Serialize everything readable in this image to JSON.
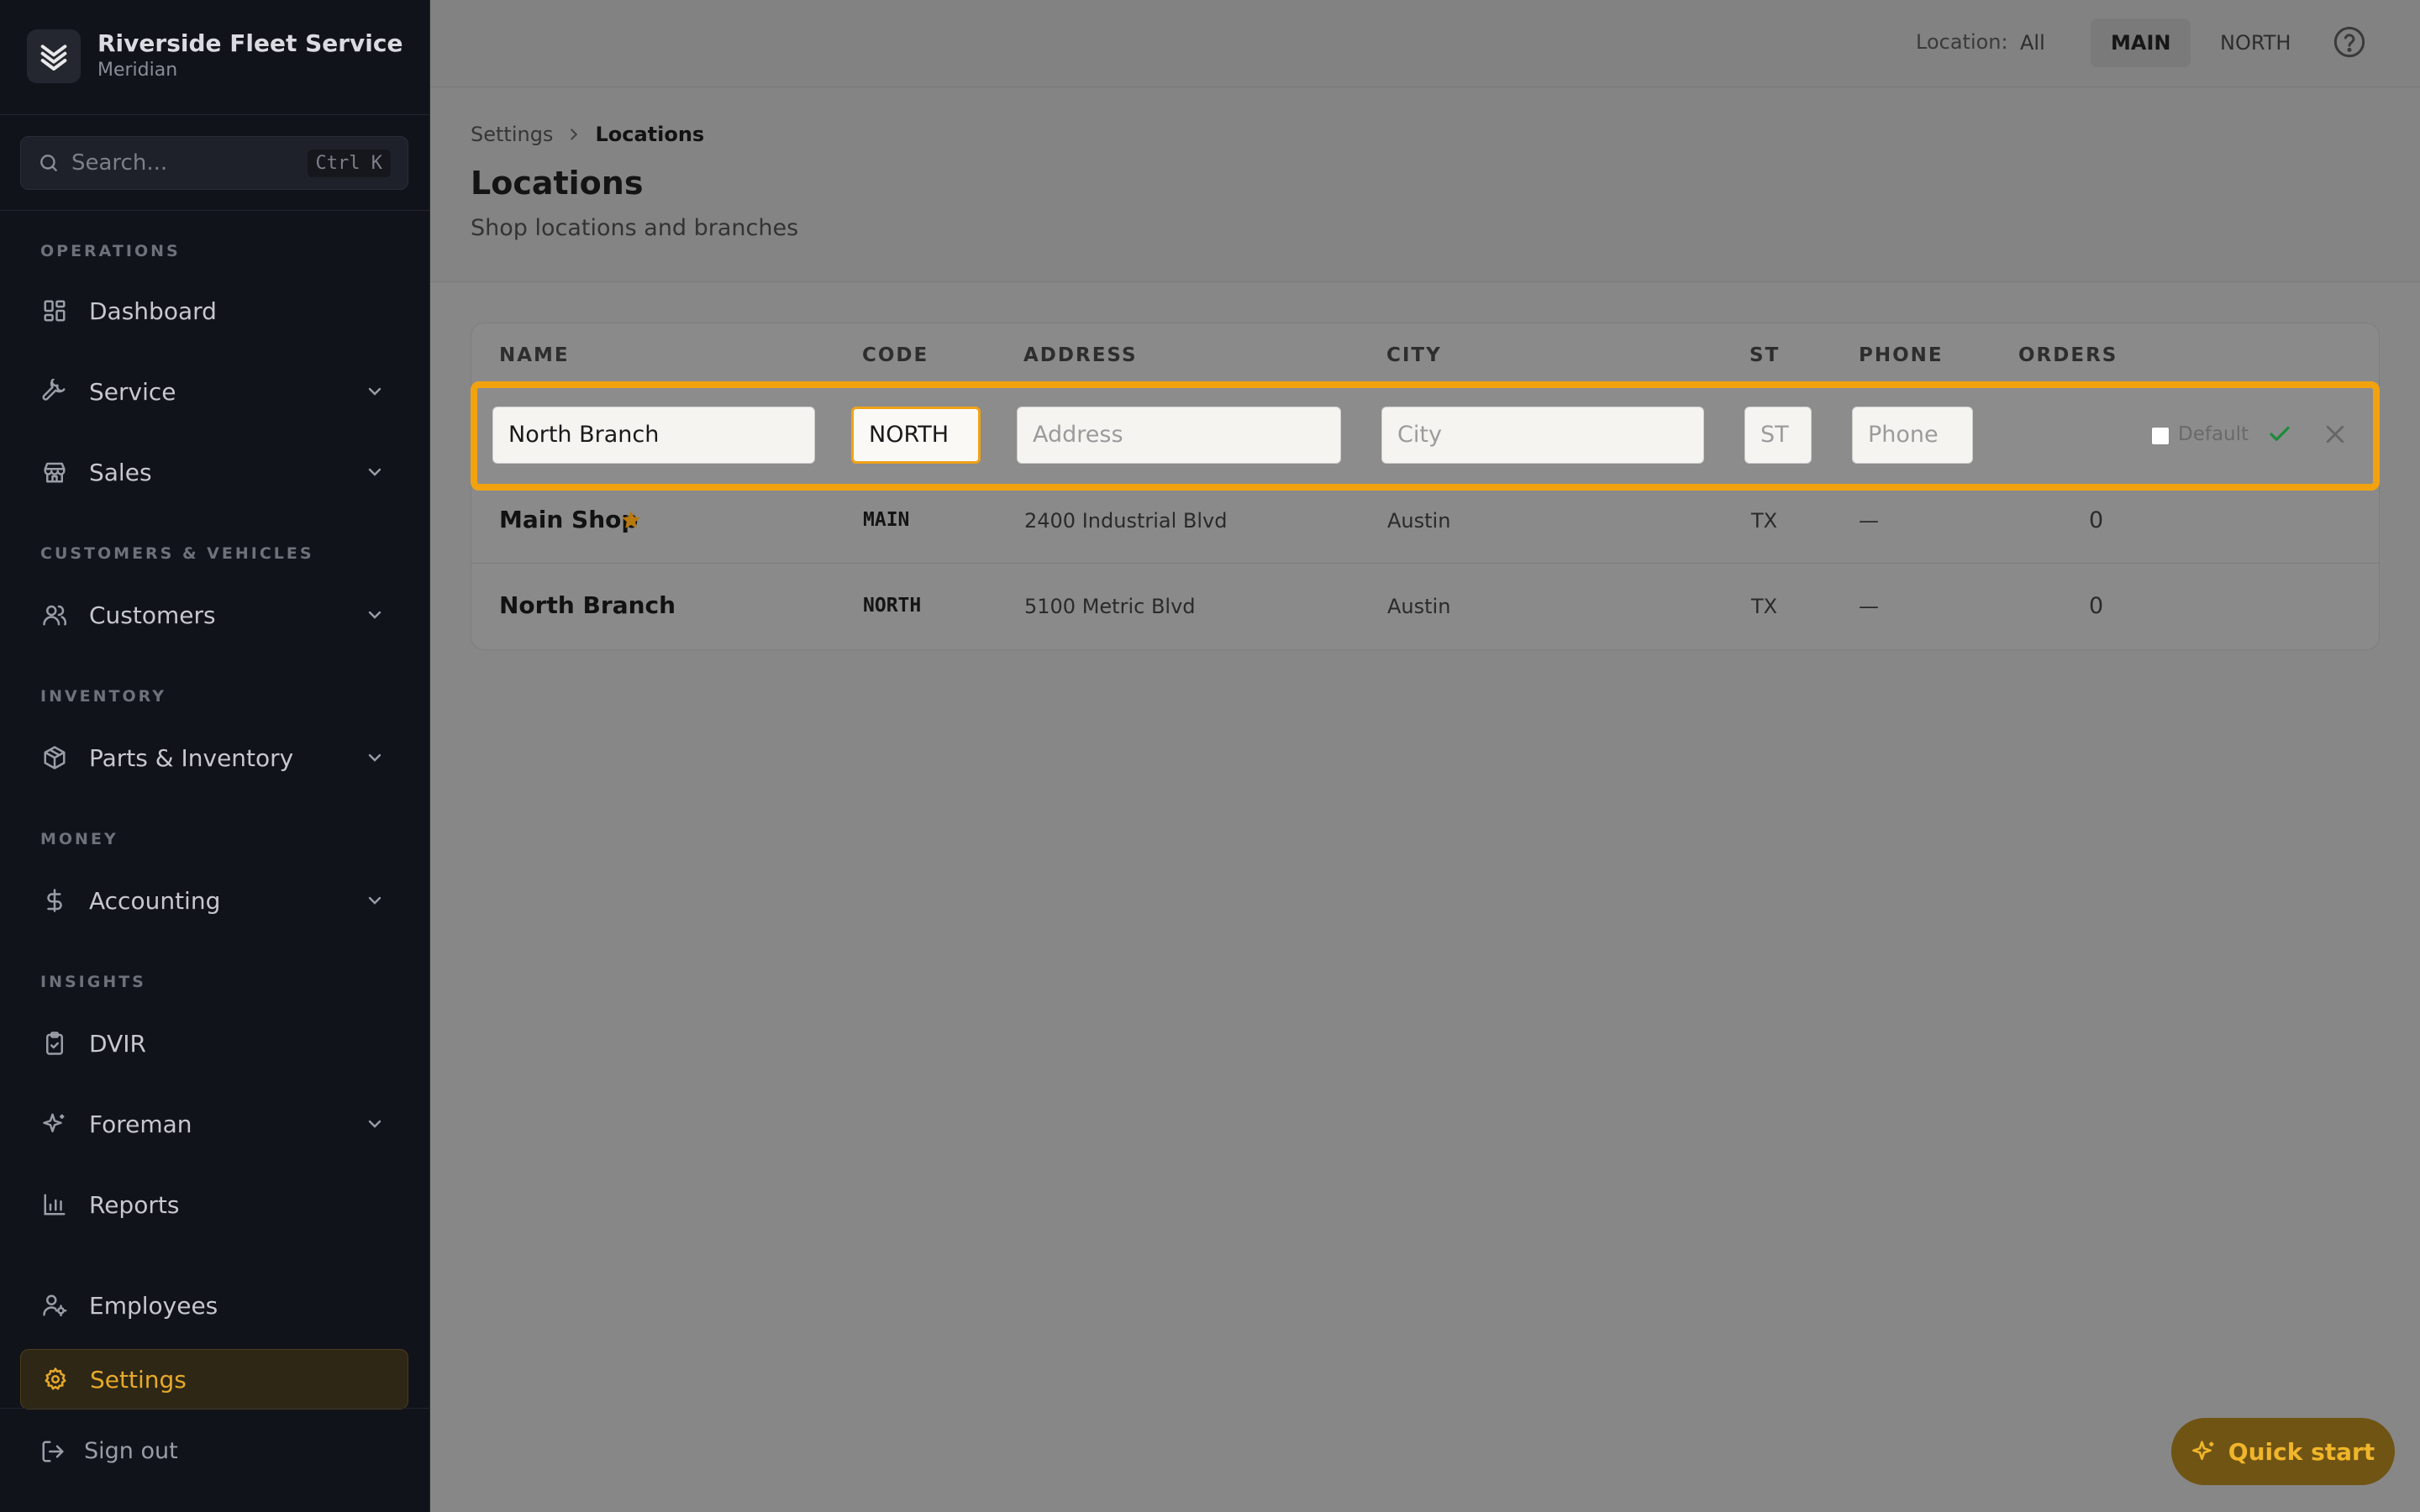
{
  "brand": {
    "name": "Riverside Fleet Service",
    "subtitle": "Meridian"
  },
  "search": {
    "placeholder": "Search...",
    "shortcut": "Ctrl K"
  },
  "sidebar": {
    "sections": [
      "OPERATIONS",
      "CUSTOMERS & VEHICLES",
      "INVENTORY",
      "MONEY",
      "INSIGHTS"
    ],
    "items": [
      {
        "label": "Dashboard",
        "icon": "dashboard-icon"
      },
      {
        "label": "Service",
        "icon": "wrench-icon"
      },
      {
        "label": "Sales",
        "icon": "store-icon"
      },
      {
        "label": "Customers",
        "icon": "users-icon"
      },
      {
        "label": "Parts & Inventory",
        "icon": "box-icon"
      },
      {
        "label": "Accounting",
        "icon": "dollar-icon"
      },
      {
        "label": "DVIR",
        "icon": "clipboard-check-icon"
      },
      {
        "label": "Foreman",
        "icon": "sparkles-icon"
      },
      {
        "label": "Reports",
        "icon": "bar-chart-icon"
      },
      {
        "label": "Employees",
        "icon": "user-cog-icon"
      },
      {
        "label": "Settings",
        "icon": "gear-icon",
        "active": true
      }
    ],
    "signout": "Sign out"
  },
  "topbar": {
    "location_label": "Location:",
    "location_options": [
      "All",
      "MAIN",
      "NORTH"
    ],
    "selected_location": "MAIN"
  },
  "breadcrumb": {
    "parent": "Settings",
    "current": "Locations"
  },
  "page": {
    "title": "Locations",
    "subtitle": "Shop locations and branches"
  },
  "table": {
    "columns": [
      "NAME",
      "CODE",
      "ADDRESS",
      "CITY",
      "ST",
      "PHONE",
      "ORDERS"
    ],
    "edit_row": {
      "name": "North Branch",
      "code": "NORTH",
      "address_placeholder": "Address",
      "city_placeholder": "City",
      "state_placeholder": "ST",
      "phone_placeholder": "Phone",
      "default_label": "Default",
      "default_checked": false
    },
    "rows": [
      {
        "name": "Main Shop",
        "is_default": true,
        "code": "MAIN",
        "address": "2400 Industrial Blvd",
        "city": "Austin",
        "state": "TX",
        "phone": "—",
        "orders": "0"
      },
      {
        "name": "North Branch",
        "is_default": false,
        "code": "NORTH",
        "address": "5100 Metric Blvd",
        "city": "Austin",
        "state": "TX",
        "phone": "—",
        "orders": "0"
      }
    ]
  },
  "quick_start": {
    "label": "Quick start"
  },
  "colors": {
    "accent": "#f2a20f",
    "sidebar_bg": "#11131a",
    "confirm": "#1d8a3d"
  }
}
